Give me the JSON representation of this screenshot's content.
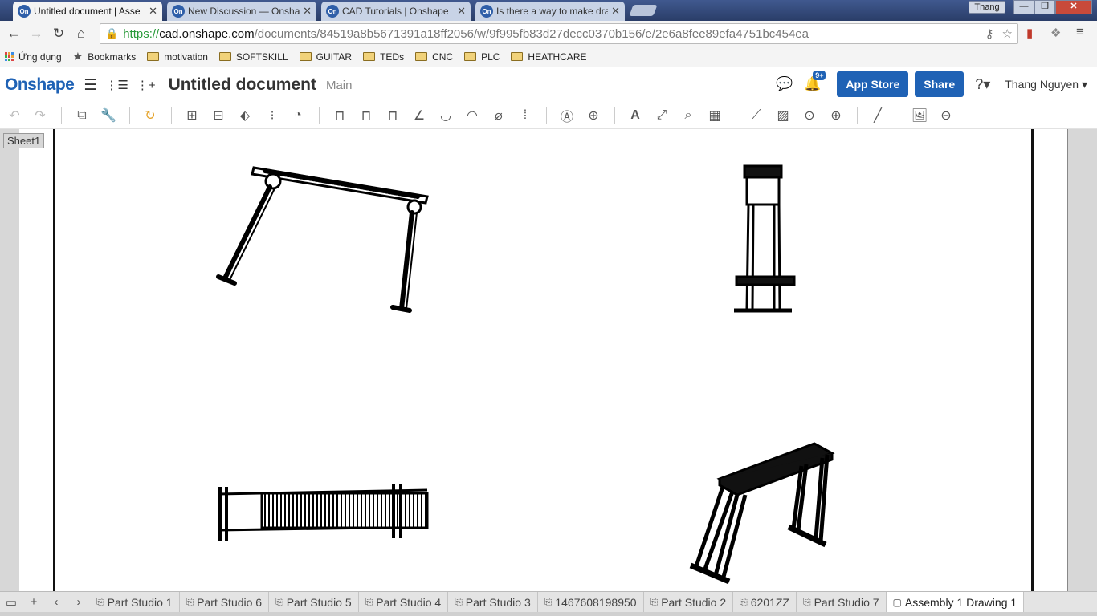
{
  "browser": {
    "tabs": [
      {
        "title": "Untitled document | Asse",
        "favicon": "On",
        "active": true
      },
      {
        "title": "New Discussion — Onsha",
        "favicon": "On",
        "active": false
      },
      {
        "title": "CAD Tutorials | Onshape",
        "favicon": "On",
        "active": false
      },
      {
        "title": "Is there a way to make dra",
        "favicon": "On",
        "active": false
      }
    ],
    "close_glyph": "✕",
    "profile_name": "Thang",
    "url_scheme": "https://",
    "url_host": "cad.onshape.com",
    "url_path": "/documents/84519a8b5671391a18ff2056/w/9f995fb83d27decc0370b156/e/2e6a8fee89efa4751bc454ea",
    "bookmarks": [
      {
        "label": "Ứng dụng",
        "type": "apps"
      },
      {
        "label": "Bookmarks",
        "type": "star"
      },
      {
        "label": "motivation",
        "type": "folder"
      },
      {
        "label": "SOFTSKILL",
        "type": "folder"
      },
      {
        "label": "GUITAR",
        "type": "folder"
      },
      {
        "label": "TEDs",
        "type": "folder"
      },
      {
        "label": "CNC",
        "type": "folder"
      },
      {
        "label": "PLC",
        "type": "folder"
      },
      {
        "label": "HEATHCARE",
        "type": "folder"
      }
    ]
  },
  "app": {
    "logo": "Onshape",
    "document_title": "Untitled document",
    "branch": "Main",
    "notification_badge": "9+",
    "app_store_label": "App Store",
    "share_label": "Share",
    "help_glyph": "?▾",
    "user_name": "Thang Nguyen ▾",
    "brand_color": "#1f62b5"
  },
  "drawing": {
    "sheet_label": "Sheet1",
    "views": [
      "front-view",
      "side-view",
      "top-view",
      "isometric-view"
    ]
  },
  "bottom_tabs": [
    {
      "label": "Part Studio 1",
      "active": false
    },
    {
      "label": "Part Studio 6",
      "active": false
    },
    {
      "label": "Part Studio 5",
      "active": false
    },
    {
      "label": "Part Studio 4",
      "active": false
    },
    {
      "label": "Part Studio 3",
      "active": false
    },
    {
      "label": "1467608198950",
      "active": false
    },
    {
      "label": "Part Studio 2",
      "active": false
    },
    {
      "label": "6201ZZ",
      "active": false
    },
    {
      "label": "Part Studio 7",
      "active": false
    },
    {
      "label": "Assembly 1 Drawing 1",
      "active": true
    }
  ]
}
